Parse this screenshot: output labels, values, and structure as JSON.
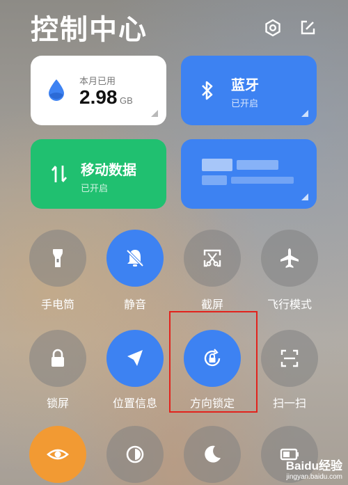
{
  "header": {
    "title": "控制中心"
  },
  "data_usage": {
    "caption": "本月已用",
    "value": "2.98",
    "unit": "GB"
  },
  "bluetooth": {
    "label": "蓝牙",
    "status": "已开启"
  },
  "mobile_data": {
    "label": "移动数据",
    "status": "已开启"
  },
  "row1": [
    {
      "label": "手电筒",
      "icon": "flashlight-icon",
      "state": "off"
    },
    {
      "label": "静音",
      "icon": "bell-mute-icon",
      "state": "on"
    },
    {
      "label": "截屏",
      "icon": "screenshot-icon",
      "state": "off"
    },
    {
      "label": "飞行模式",
      "icon": "airplane-icon",
      "state": "off"
    }
  ],
  "row2": [
    {
      "label": "锁屏",
      "icon": "lock-icon",
      "state": "off"
    },
    {
      "label": "位置信息",
      "icon": "location-icon",
      "state": "on"
    },
    {
      "label": "方向锁定",
      "icon": "rotation-lock-icon",
      "state": "on"
    },
    {
      "label": "扫一扫",
      "icon": "scan-icon",
      "state": "off"
    }
  ],
  "row3_icons": [
    "eye-icon",
    "contrast-icon",
    "moon-icon",
    "battery-icon"
  ],
  "watermark": {
    "text": "Baidu经验",
    "url": "jingyan.baidu.com"
  },
  "colors": {
    "blue": "#3d82f2",
    "green": "#20c070",
    "orange": "#f29a33",
    "highlight": "#e2221c"
  }
}
